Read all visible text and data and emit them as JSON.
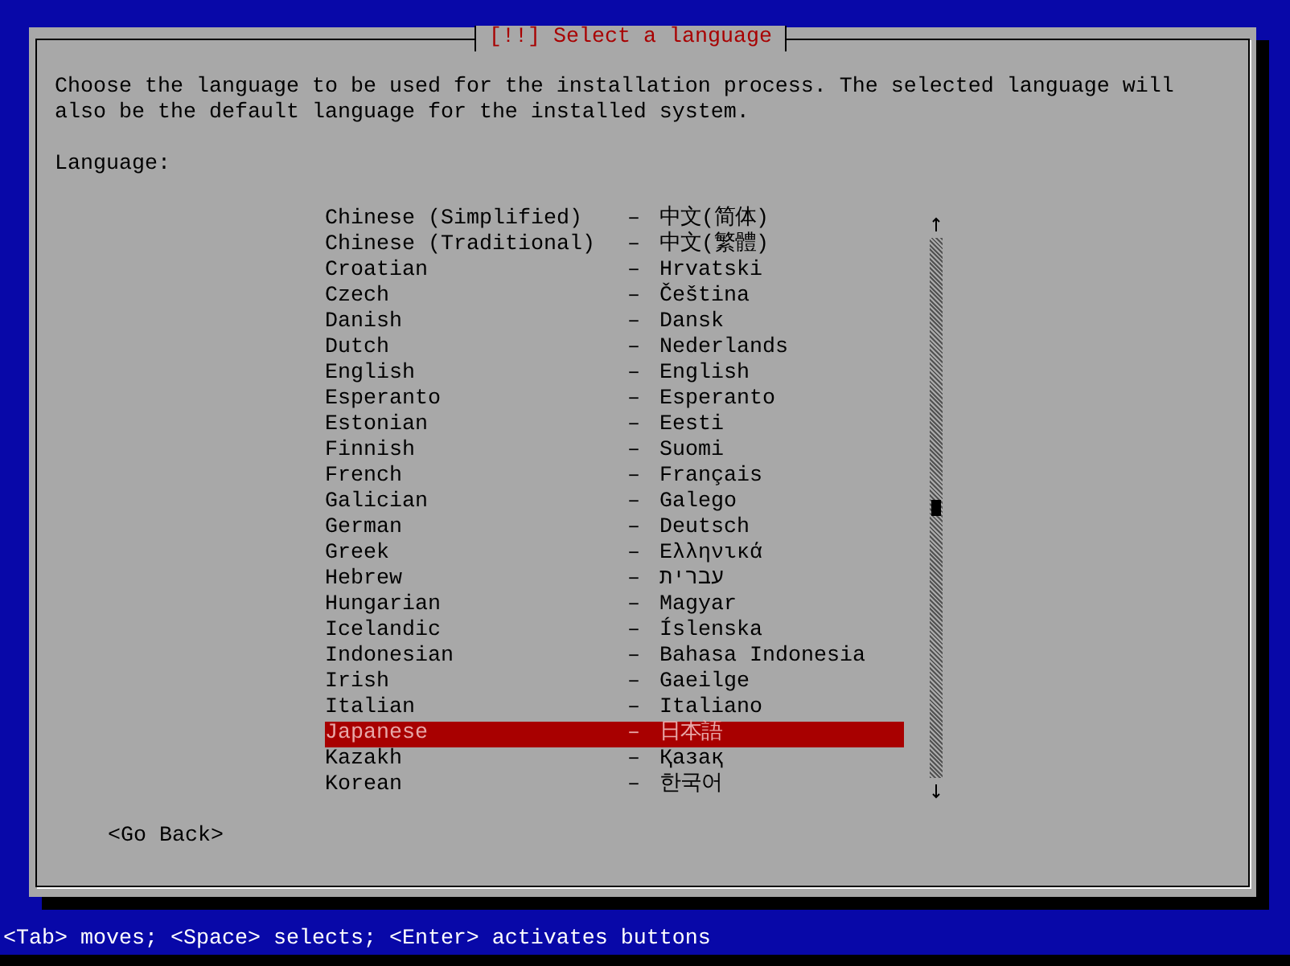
{
  "dialog": {
    "title": "[!!] Select a language",
    "description": "Choose the language to be used for the installation process. The selected language will also be the default language for the installed system.",
    "list_label": "Language:",
    "languages": [
      {
        "name": "Chinese (Simplified)",
        "separator": "–",
        "native": "中文(简体)",
        "selected": false
      },
      {
        "name": "Chinese (Traditional)",
        "separator": "–",
        "native": "中文(繁體)",
        "selected": false
      },
      {
        "name": "Croatian",
        "separator": "–",
        "native": "Hrvatski",
        "selected": false
      },
      {
        "name": "Czech",
        "separator": "–",
        "native": "Čeština",
        "selected": false
      },
      {
        "name": "Danish",
        "separator": "–",
        "native": "Dansk",
        "selected": false
      },
      {
        "name": "Dutch",
        "separator": "–",
        "native": "Nederlands",
        "selected": false
      },
      {
        "name": "English",
        "separator": "–",
        "native": "English",
        "selected": false
      },
      {
        "name": "Esperanto",
        "separator": "–",
        "native": "Esperanto",
        "selected": false
      },
      {
        "name": "Estonian",
        "separator": "–",
        "native": "Eesti",
        "selected": false
      },
      {
        "name": "Finnish",
        "separator": "–",
        "native": "Suomi",
        "selected": false
      },
      {
        "name": "French",
        "separator": "–",
        "native": "Français",
        "selected": false
      },
      {
        "name": "Galician",
        "separator": "–",
        "native": "Galego",
        "selected": false
      },
      {
        "name": "German",
        "separator": "–",
        "native": "Deutsch",
        "selected": false
      },
      {
        "name": "Greek",
        "separator": "–",
        "native": "Ελληνικά",
        "selected": false
      },
      {
        "name": "Hebrew",
        "separator": "–",
        "native": "עברית",
        "selected": false
      },
      {
        "name": "Hungarian",
        "separator": "–",
        "native": "Magyar",
        "selected": false
      },
      {
        "name": "Icelandic",
        "separator": "–",
        "native": "Íslenska",
        "selected": false
      },
      {
        "name": "Indonesian",
        "separator": "–",
        "native": "Bahasa Indonesia",
        "selected": false
      },
      {
        "name": "Irish",
        "separator": "–",
        "native": "Gaeilge",
        "selected": false
      },
      {
        "name": "Italian",
        "separator": "–",
        "native": "Italiano",
        "selected": false
      },
      {
        "name": "Japanese",
        "separator": "–",
        "native": "日本語",
        "selected": true
      },
      {
        "name": "Kazakh",
        "separator": "–",
        "native": "Қазақ",
        "selected": false
      },
      {
        "name": "Korean",
        "separator": "–",
        "native": "한국어",
        "selected": false
      }
    ],
    "buttons": [
      {
        "label": "<Go Back>"
      }
    ]
  },
  "status_bar": "<Tab> moves; <Space> selects; <Enter> activates buttons"
}
